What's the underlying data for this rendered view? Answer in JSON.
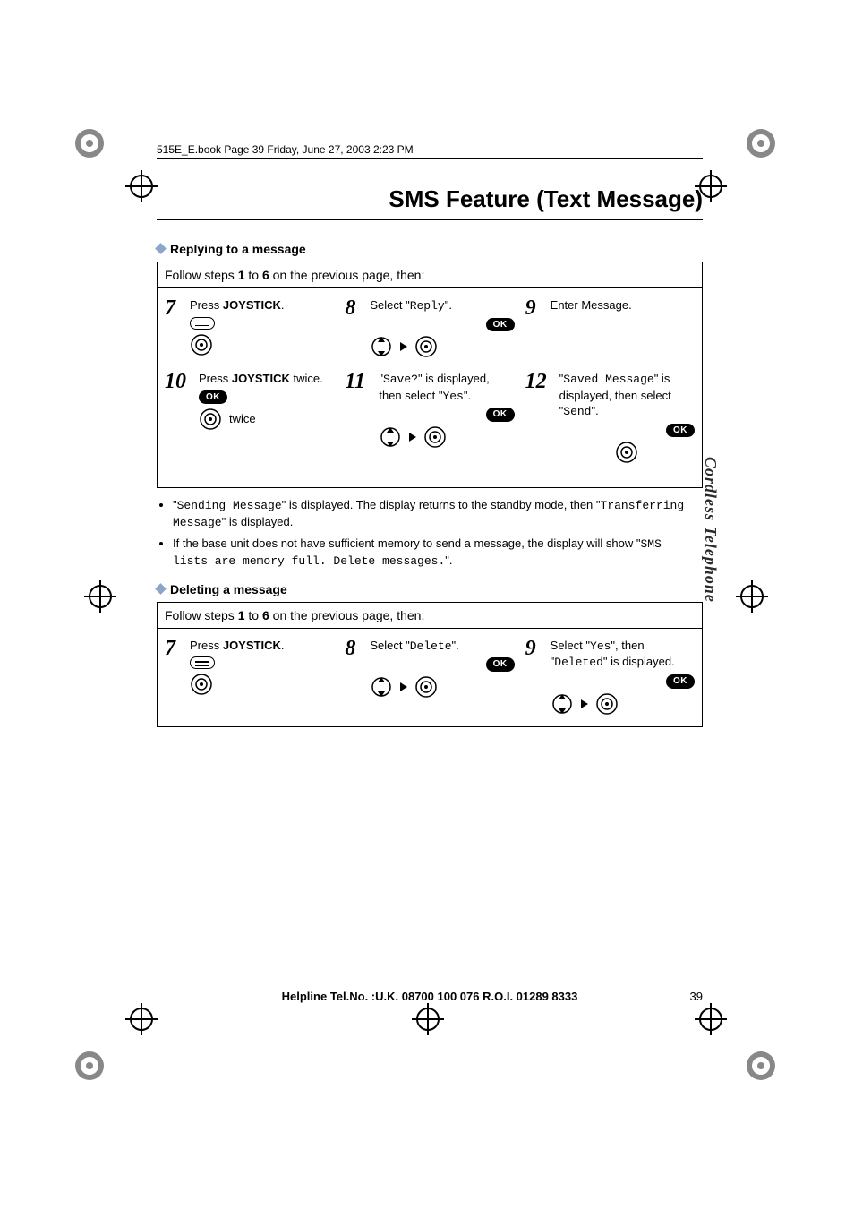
{
  "book_header": "515E_E.book  Page 39  Friday, June 27, 2003  2:23 PM",
  "page_title": "SMS Feature (Text Message)",
  "side_tab": "Cordless Telephone",
  "section_reply": {
    "heading": "Replying to a message",
    "follow_prefix": "Follow steps ",
    "follow_b1": "1",
    "follow_mid": " to ",
    "follow_b2": "6",
    "follow_suffix": " on the previous page, then:",
    "steps": {
      "7": {
        "num": "7",
        "t1": "Press ",
        "b1": "JOYSTICK",
        "t2": "."
      },
      "8": {
        "num": "8",
        "t1": "Select \"",
        "m1": "Reply",
        "t2": "\".",
        "ok": "OK"
      },
      "9": {
        "num": "9",
        "t1": "Enter Message."
      },
      "10": {
        "num": "10",
        "t1": "Press ",
        "b1": "JOYSTICK",
        "t2": " twice.",
        "ok": "OK",
        "twice": "twice"
      },
      "11": {
        "num": "11",
        "t1": "\"",
        "m1": "Save?",
        "t2": "\" is displayed, then select \"",
        "m2": "Yes",
        "t3": "\".",
        "ok": "OK"
      },
      "12": {
        "num": "12",
        "t1": "\"",
        "m1": "Saved Message",
        "t2": "\" is displayed, then select \"",
        "m2": "Send",
        "t3": "\".",
        "ok": "OK"
      }
    }
  },
  "notes": {
    "n1_a": "\"",
    "n1_m1": "Sending Message",
    "n1_b": "\" is displayed. The display returns to the standby mode, then \"",
    "n1_m2": "Transferring Message",
    "n1_c": "\" is displayed.",
    "n2_a": "If the base unit does not have sufficient memory to send a message, the display will show \"",
    "n2_m1": "SMS lists are memory full. Delete messages.",
    "n2_b": "\"."
  },
  "section_delete": {
    "heading": "Deleting a message",
    "follow_prefix": "Follow steps ",
    "follow_b1": "1",
    "follow_mid": " to ",
    "follow_b2": "6",
    "follow_suffix": " on the previous page, then:",
    "steps": {
      "7": {
        "num": "7",
        "t1": "Press ",
        "b1": "JOYSTICK",
        "t2": "."
      },
      "8": {
        "num": "8",
        "t1": "Select \"",
        "m1": "Delete",
        "t2": "\".",
        "ok": "OK"
      },
      "9": {
        "num": "9",
        "t1": "Select \"",
        "m1": "Yes",
        "t2": "\", then \"",
        "m2": "Deleted",
        "t3": "\" is displayed.",
        "ok": "OK"
      }
    }
  },
  "footer": {
    "helpline": "Helpline Tel.No. :U.K. 08700 100 076  R.O.I. 01289 8333",
    "page": "39"
  }
}
